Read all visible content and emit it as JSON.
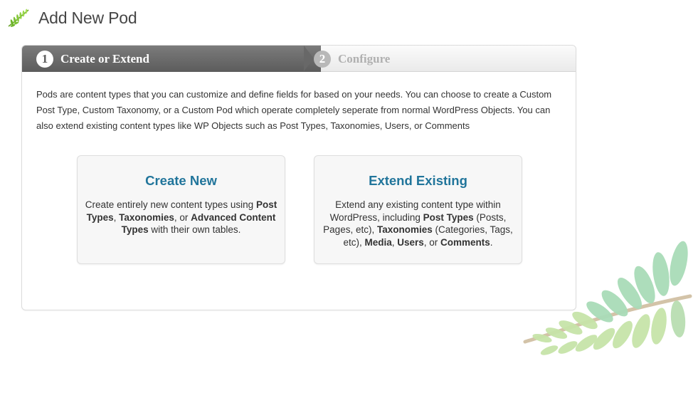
{
  "header": {
    "title": "Add New Pod",
    "logo_icon": "pods-leaf-logo-icon"
  },
  "wizard": {
    "steps": [
      {
        "number": "1",
        "label": "Create or Extend",
        "active": true
      },
      {
        "number": "2",
        "label": "Configure",
        "active": false
      }
    ],
    "intro": "Pods are content types that you can customize and define fields for based on your needs. You can choose to create a Custom Post Type, Custom Taxonomy, or a Custom Pod which operate completely seperate from normal WordPress Objects. You can also extend existing content types like WP Objects such as Post Types, Taxonomies, Users, or Comments",
    "create": {
      "title": "Create New",
      "desc": {
        "t1": "Create entirely new content types using ",
        "b1": "Post Types",
        "t2": ", ",
        "b2": "Taxonomies",
        "t3": ", or ",
        "b3": "Advanced Content Types",
        "t4": " with their own tables."
      }
    },
    "extend": {
      "title": "Extend Existing",
      "desc": {
        "t1": "Extend any existing content type within WordPress, including ",
        "b1": "Post Types",
        "t2": " (Posts, Pages, etc), ",
        "b2": "Taxonomies",
        "t3": " (Categories, Tags, etc), ",
        "b3": "Media",
        "t4": ", ",
        "b4": "Users",
        "t5": ", or ",
        "b5": "Comments",
        "t6": "."
      }
    }
  },
  "colors": {
    "accent_link": "#21759b",
    "active_step": "#686868",
    "inactive_step": "#b8b8b8",
    "leaf_green": "#9fd6a6",
    "leaf_light": "#d6e9a8",
    "stem": "#d3c3a8"
  }
}
